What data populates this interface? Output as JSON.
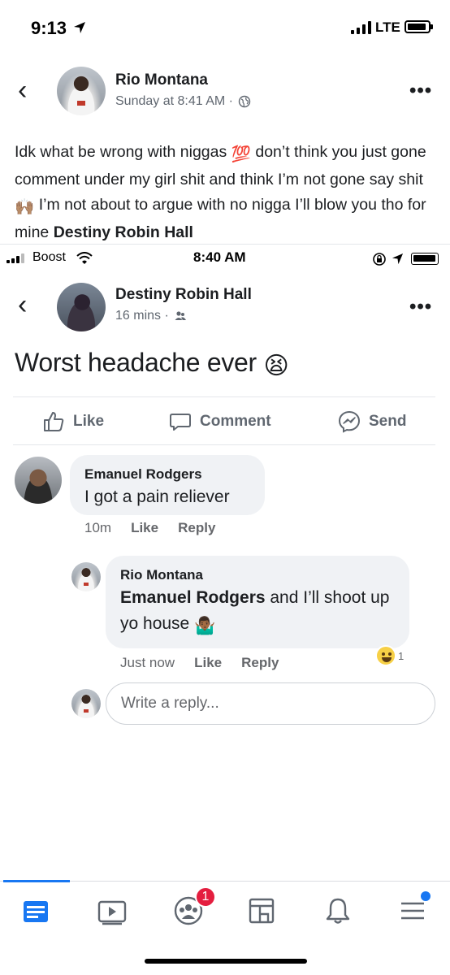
{
  "status_bar": {
    "time": "9:13",
    "network": "LTE"
  },
  "post": {
    "author": "Rio Montana",
    "meta": "Sunday at 8:41 AM ·",
    "text_parts": [
      "Idk what be wrong with niggas ",
      "💯",
      " don’t think you just gone comment under my girl shit and think I’m not gone say shit ",
      "🙌🏽",
      " I’m not about to argue with no nigga I’ll blow you tho for mine "
    ],
    "tag": "Destiny Robin Hall"
  },
  "screenshot": {
    "status_bar": {
      "carrier": "Boost",
      "time": "8:40 AM"
    },
    "author": "Destiny Robin Hall",
    "meta": "16 mins ·",
    "status": "Worst headache ever",
    "status_emoji": "😫",
    "actions": {
      "like": "Like",
      "comment": "Comment",
      "send": "Send"
    },
    "comments": [
      {
        "name": "Emanuel Rodgers",
        "text": "I got a pain reliever",
        "time": "10m",
        "like": "Like",
        "reply": "Reply"
      }
    ],
    "reply": {
      "name": "Rio Montana",
      "mention": "Emanuel Rodgers",
      "text": " and I’ll shoot up yo house ",
      "emoji": "🤷🏾‍♂️",
      "time": "Just now",
      "like": "Like",
      "reply": "Reply",
      "reaction_count": "1"
    },
    "reply_placeholder": "Write a reply..."
  },
  "tabbar": {
    "notifications_badge": "1"
  }
}
